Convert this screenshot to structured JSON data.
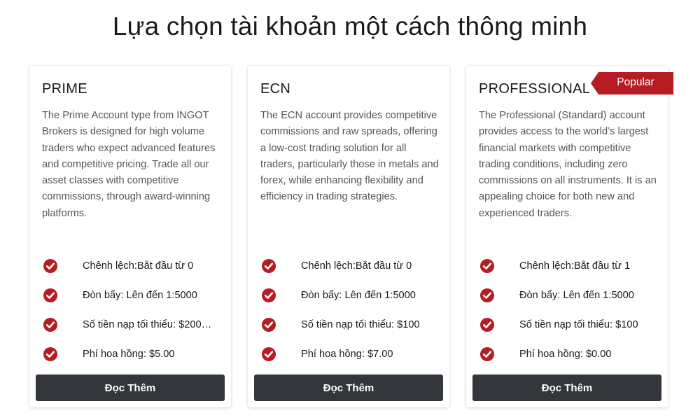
{
  "page": {
    "title": "Lựa chọn tài khoản một cách thông minh"
  },
  "colors": {
    "accent_red": "#b71c23",
    "button_dark": "#33363a"
  },
  "cards": [
    {
      "title": "PRIME",
      "description": "The Prime Account type from INGOT Brokers is designed for high volume traders who expect advanced features and competitive pricing. Trade all our asset classes with competitive commissions, through award-winning platforms.",
      "features": [
        "Chênh lệch:Bắt đầu từ 0",
        "Đòn bẩy: Lên đến 1:5000",
        "Số tiền nạp tối thiểu: $200…",
        "Phí hoa hồng: $5.00"
      ],
      "button_label": "Đọc Thêm",
      "icon": "check-circle-icon"
    },
    {
      "title": "ECN",
      "description": "The ECN account provides competitive commissions and raw spreads, offering a low-cost trading solution for all traders, particularly those in metals and forex, while enhancing flexibility and efficiency in trading strategies.",
      "features": [
        "Chênh lệch:Bắt đầu từ 0",
        "Đòn bẩy: Lên đến 1:5000",
        "Số tiền nạp tối thiểu: $100",
        "Phí hoa hồng: $7.00"
      ],
      "button_label": "Đọc Thêm",
      "icon": "check-circle-icon"
    },
    {
      "title": "PROFESSIONAL",
      "badge": "Popular",
      "description": "The Professional (Standard) account provides access to the world’s largest financial markets with competitive trading conditions, including zero commissions on all instruments. It is an appealing choice for both new and experienced traders.",
      "features": [
        "Chênh lệch:Bắt đầu từ 1",
        "Đòn bẩy: Lên đến 1:5000",
        "Số tiền nạp tối thiểu: $100",
        "Phí hoa hồng: $0.00"
      ],
      "button_label": "Đọc Thêm",
      "icon": "check-circle-icon"
    }
  ]
}
